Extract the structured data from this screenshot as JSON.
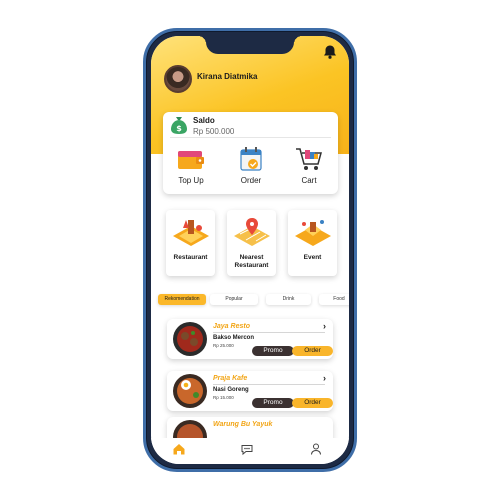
{
  "user": {
    "name": "Kirana Diatmika"
  },
  "balance": {
    "label": "Saldo",
    "value": "Rp 500.000"
  },
  "actions": [
    {
      "label": "Top Up",
      "icon": "wallet-icon"
    },
    {
      "label": "Order",
      "icon": "calendar-check-icon"
    },
    {
      "label": "Cart",
      "icon": "cart-icon"
    }
  ],
  "services": [
    {
      "label": "Restaurant",
      "icon": "restaurant-isometric-icon"
    },
    {
      "label": "Nearest Restaurant",
      "icon": "map-pin-icon"
    },
    {
      "label": "Event",
      "icon": "event-isometric-icon"
    }
  ],
  "categories": [
    {
      "label": "Rekomendation",
      "active": true
    },
    {
      "label": "Popular",
      "active": false
    },
    {
      "label": "Drink",
      "active": false
    },
    {
      "label": "Food",
      "active": false
    }
  ],
  "restaurants": [
    {
      "name": "Jaya Resto",
      "menu": "Bakso Mercon",
      "price": "Rp 25.000"
    },
    {
      "name": "Praja Kafe",
      "menu": "Nasi Goreng",
      "price": "Rp 15.000"
    },
    {
      "name": "Warung Bu Yayuk",
      "menu": "",
      "price": ""
    }
  ],
  "buttons": {
    "promo": "Promo",
    "order": "Order"
  },
  "nav": [
    {
      "icon": "home-icon",
      "active": true
    },
    {
      "icon": "chat-icon",
      "active": false
    },
    {
      "icon": "profile-icon",
      "active": false
    }
  ],
  "colors": {
    "accent": "#fbb82a",
    "header_gradient_end": "#f7b21a",
    "name_text": "#f2a516",
    "dark_button": "#3b3131"
  }
}
